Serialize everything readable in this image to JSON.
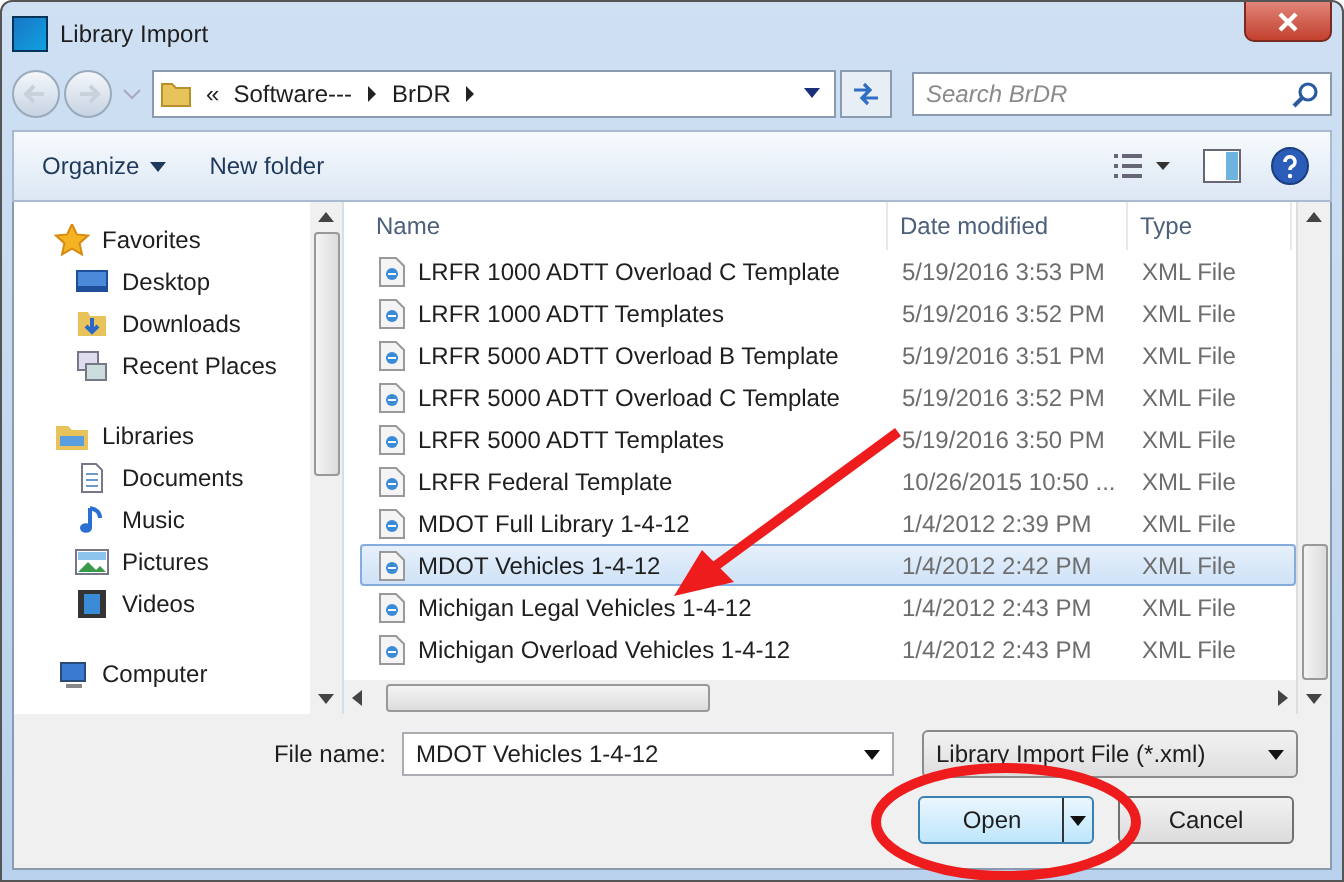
{
  "window": {
    "title": "Library Import"
  },
  "address": {
    "crumbs": [
      "«",
      "Software---",
      "BrDR"
    ],
    "search_placeholder": "Search BrDR"
  },
  "toolbar": {
    "organize": "Organize",
    "new_folder": "New folder"
  },
  "sidebar": [
    {
      "kind": "group",
      "label": "Favorites"
    },
    {
      "kind": "item",
      "label": "Desktop"
    },
    {
      "kind": "item",
      "label": "Downloads"
    },
    {
      "kind": "item",
      "label": "Recent Places"
    },
    {
      "kind": "group",
      "label": "Libraries"
    },
    {
      "kind": "item",
      "label": "Documents"
    },
    {
      "kind": "item",
      "label": "Music"
    },
    {
      "kind": "item",
      "label": "Pictures"
    },
    {
      "kind": "item",
      "label": "Videos"
    },
    {
      "kind": "group",
      "label": "Computer"
    }
  ],
  "table": {
    "columns": [
      "Name",
      "Date modified",
      "Type"
    ],
    "rows": [
      {
        "name": "LRFR 1000 ADTT Overload C Template",
        "date": "5/19/2016 3:53 PM",
        "type": "XML File",
        "selected": false
      },
      {
        "name": "LRFR 1000 ADTT Templates",
        "date": "5/19/2016 3:52 PM",
        "type": "XML File",
        "selected": false
      },
      {
        "name": "LRFR 5000 ADTT Overload B Template",
        "date": "5/19/2016 3:51 PM",
        "type": "XML File",
        "selected": false
      },
      {
        "name": "LRFR 5000 ADTT Overload C Template",
        "date": "5/19/2016 3:52 PM",
        "type": "XML File",
        "selected": false
      },
      {
        "name": "LRFR 5000 ADTT Templates",
        "date": "5/19/2016 3:50 PM",
        "type": "XML File",
        "selected": false
      },
      {
        "name": "LRFR Federal Template",
        "date": "10/26/2015 10:50 ...",
        "type": "XML File",
        "selected": false
      },
      {
        "name": "MDOT Full Library 1-4-12",
        "date": "1/4/2012 2:39 PM",
        "type": "XML File",
        "selected": false
      },
      {
        "name": "MDOT Vehicles 1-4-12",
        "date": "1/4/2012 2:42 PM",
        "type": "XML File",
        "selected": true
      },
      {
        "name": "Michigan Legal Vehicles 1-4-12",
        "date": "1/4/2012 2:43 PM",
        "type": "XML File",
        "selected": false
      },
      {
        "name": "Michigan Overload Vehicles 1-4-12",
        "date": "1/4/2012 2:43 PM",
        "type": "XML File",
        "selected": false
      }
    ]
  },
  "file_name": {
    "label": "File name:",
    "value": "MDOT Vehicles 1-4-12"
  },
  "file_type": "Library Import File (*.xml)",
  "buttons": {
    "open": "Open",
    "cancel": "Cancel"
  }
}
